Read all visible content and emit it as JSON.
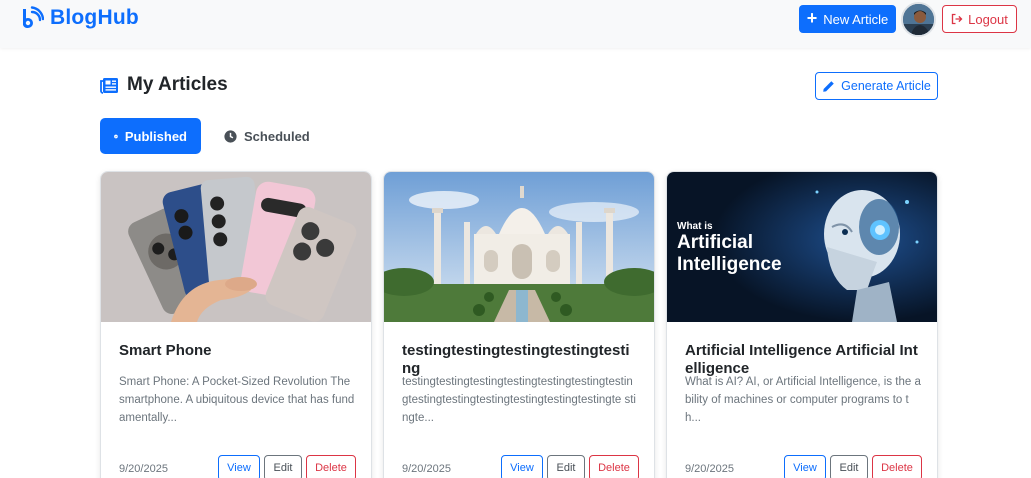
{
  "brand": {
    "name": "BlogHub"
  },
  "navbar": {
    "new_article_label": "New Article",
    "logout_label": "Logout"
  },
  "page": {
    "title": "My Articles",
    "generate_label": "Generate Article"
  },
  "tabs": [
    {
      "label": "Published",
      "active": true
    },
    {
      "label": "Scheduled",
      "active": false
    }
  ],
  "articles": [
    {
      "title": "Smart Phone",
      "excerpt": "Smart Phone: A Pocket-Sized Revolution The smartphone. A ubiquitous device that has fundamentally...",
      "date": "9/20/2025",
      "image": "smartphones-photo"
    },
    {
      "title": "testingtestingtestingtestingtesting",
      "excerpt": "testingtestingtestingtestingtestingtestingtestingtestingtestingtestingtestingtestingtestingte stingte...",
      "date": "9/20/2025",
      "image": "taj-mahal-photo"
    },
    {
      "title": "Artificial Intelligence Artificial Intelligence",
      "excerpt": "What is AI? AI, or Artificial Intelligence, is the ability of machines or computer programs to th...",
      "date": "9/20/2025",
      "image": "ai-robot-graphic",
      "image_text": {
        "line1": "What is",
        "line2": "Artificial",
        "line3": "Intelligence"
      }
    }
  ],
  "card_actions": {
    "view": "View",
    "edit": "Edit",
    "delete": "Delete"
  },
  "colors": {
    "primary": "#0d6efd",
    "danger": "#dc3545",
    "secondary": "#6c757d",
    "navbar_bg": "#f8f9fa"
  }
}
